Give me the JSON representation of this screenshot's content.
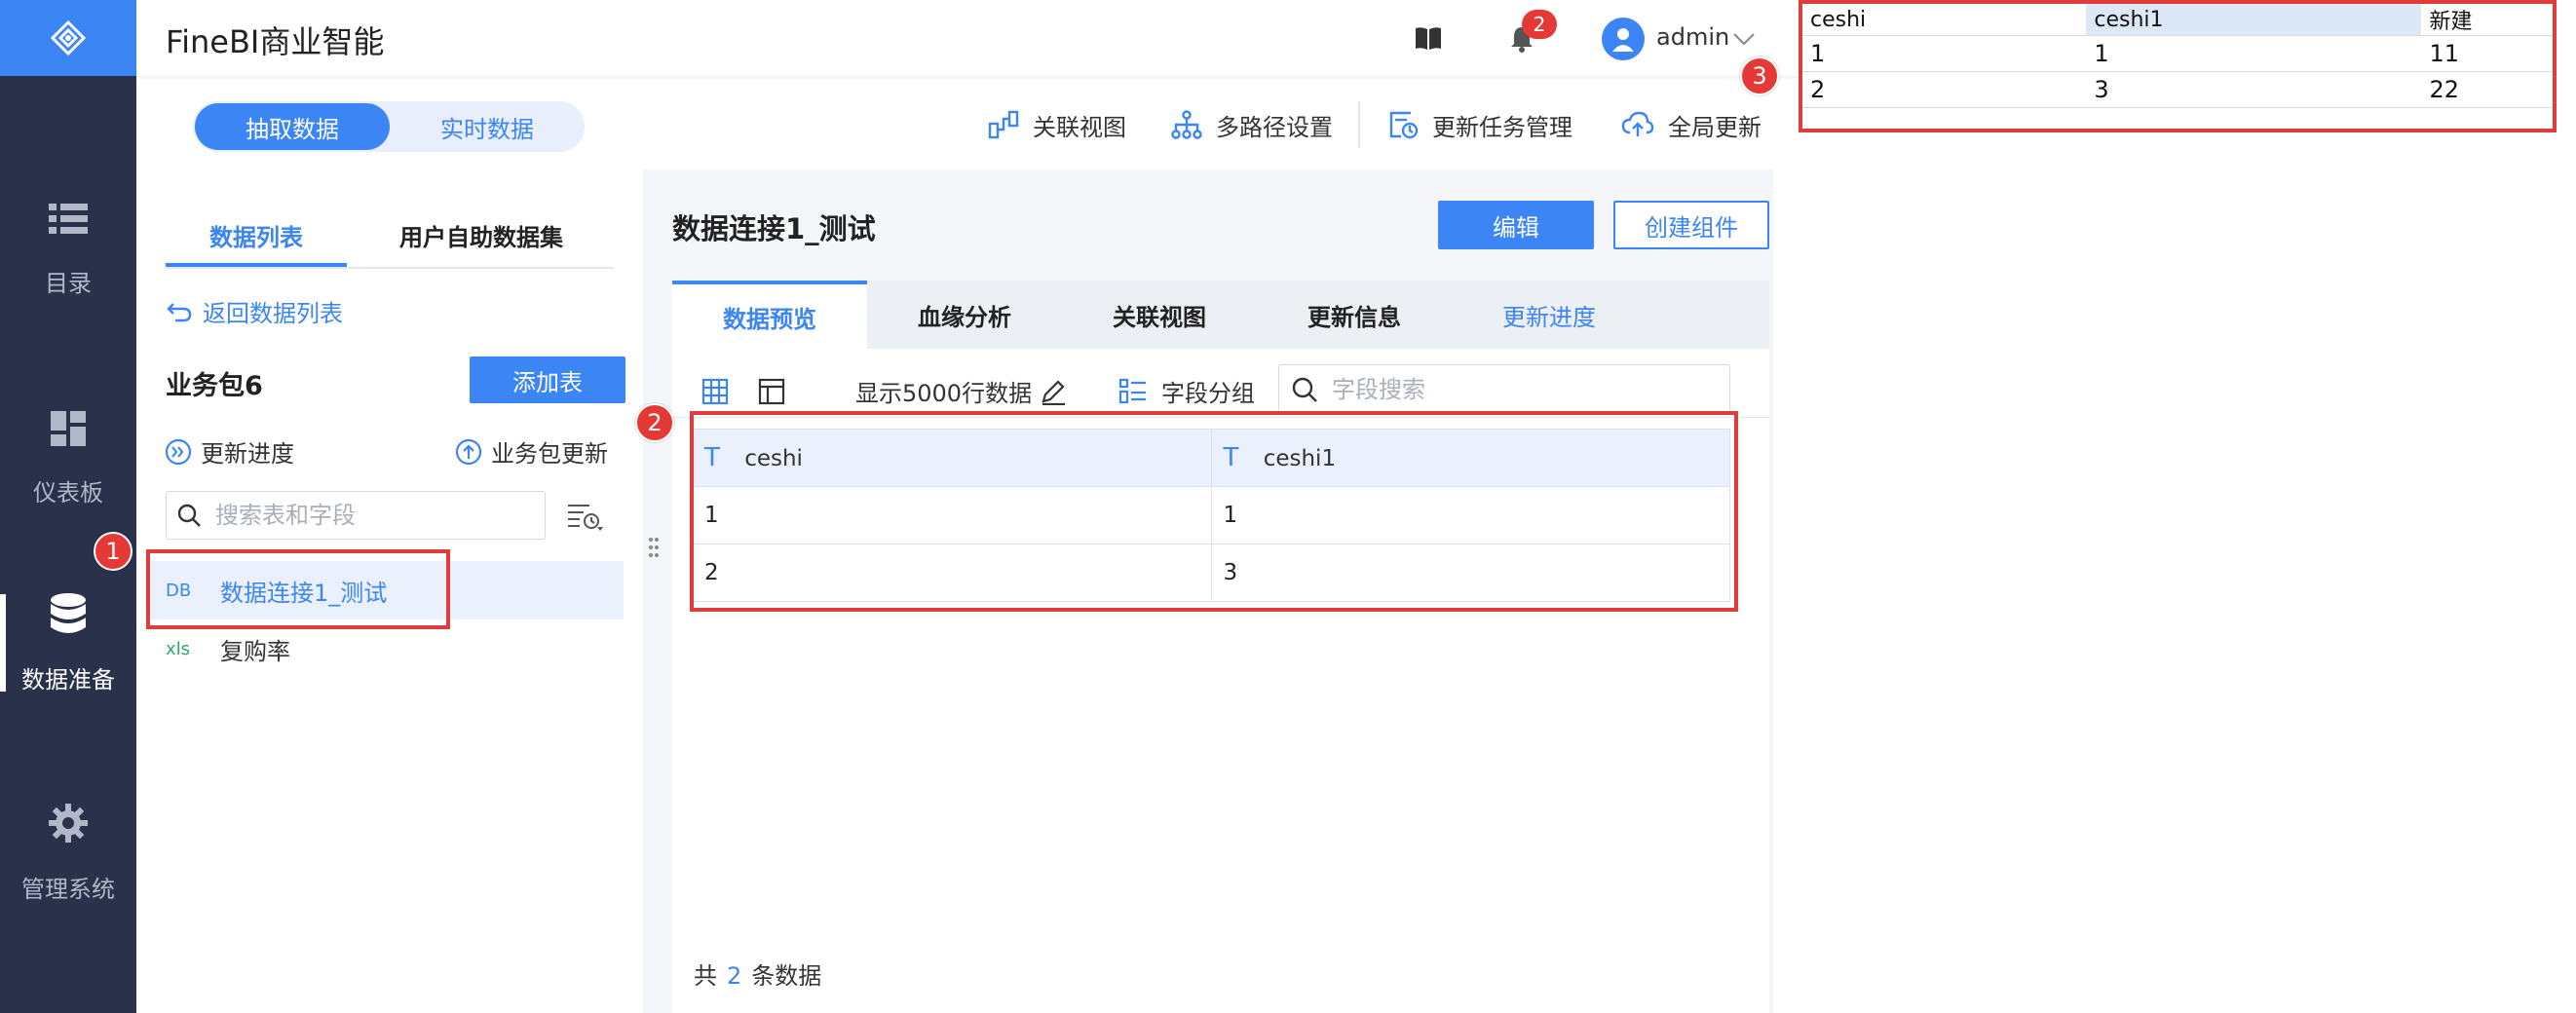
{
  "app": {
    "title": "FineBI商业智能",
    "notification_count": "2",
    "username": "admin",
    "brand_color": "#3c85f4"
  },
  "nav": {
    "items": [
      {
        "label": "目录",
        "icon": "list-icon"
      },
      {
        "label": "仪表板",
        "icon": "dashboard-icon"
      },
      {
        "label": "数据准备",
        "icon": "database-icon",
        "active": true
      },
      {
        "label": "管理系统",
        "icon": "gear-icon"
      }
    ]
  },
  "mode_toggle": {
    "extract": "抽取数据",
    "realtime": "实时数据",
    "selected": "抽取数据"
  },
  "toolbar": {
    "relation_view": "关联视图",
    "multipath": "多路径设置",
    "task_manage": "更新任务管理",
    "global_update": "全局更新"
  },
  "left_panel": {
    "tabs": [
      "数据列表",
      "用户自助数据集"
    ],
    "back_link": "返回数据列表",
    "package_name": "业务包6",
    "add_table": "添加表",
    "update_progress": "更新进度",
    "package_update": "业务包更新",
    "search_placeholder": "搜索表和字段",
    "tables": [
      {
        "type": "DB",
        "name": "数据连接1_测试",
        "selected": true
      },
      {
        "type": "xls",
        "name": "复购率"
      }
    ]
  },
  "content": {
    "title": "数据连接1_测试",
    "edit": "编辑",
    "create_widget": "创建组件",
    "tabs": [
      "数据预览",
      "血缘分析",
      "关联视图",
      "更新信息",
      "更新进度"
    ],
    "show_rows": "显示5000行数据",
    "field_group": "字段分组",
    "field_search_placeholder": "字段搜索",
    "columns": [
      "ceshi",
      "ceshi1"
    ],
    "col_type_glyph": "T",
    "rows": [
      [
        "1",
        "1"
      ],
      [
        "2",
        "3"
      ]
    ],
    "count_prefix": "共",
    "count": "2",
    "count_suffix": "条数据"
  },
  "annotations": {
    "m1": "1",
    "m2": "2",
    "m3": "3",
    "color": "#e03c3c"
  },
  "excel": {
    "headers": [
      "ceshi",
      "ceshi1",
      "新建"
    ],
    "rows": [
      [
        "1",
        "1",
        "11"
      ],
      [
        "2",
        "3",
        "22"
      ]
    ]
  }
}
